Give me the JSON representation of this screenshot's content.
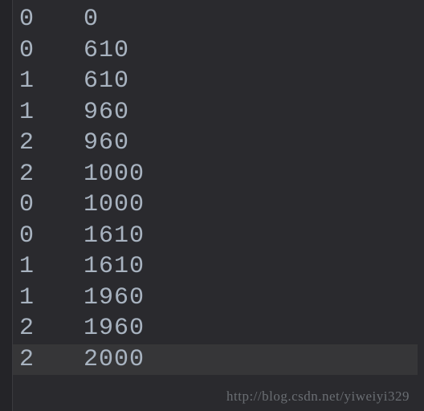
{
  "rows": [
    {
      "col1": "0",
      "col2": "0"
    },
    {
      "col1": "0",
      "col2": "610"
    },
    {
      "col1": "1",
      "col2": "610"
    },
    {
      "col1": "1",
      "col2": "960"
    },
    {
      "col1": "2",
      "col2": "960"
    },
    {
      "col1": "2",
      "col2": "1000"
    },
    {
      "col1": "0",
      "col2": "1000"
    },
    {
      "col1": "0",
      "col2": "1610"
    },
    {
      "col1": "1",
      "col2": "1610"
    },
    {
      "col1": "1",
      "col2": "1960"
    },
    {
      "col1": "2",
      "col2": "1960"
    },
    {
      "col1": "2",
      "col2": "2000"
    }
  ],
  "highlighted_index": 11,
  "watermark": "http://blog.csdn.net/yiweiyi329"
}
